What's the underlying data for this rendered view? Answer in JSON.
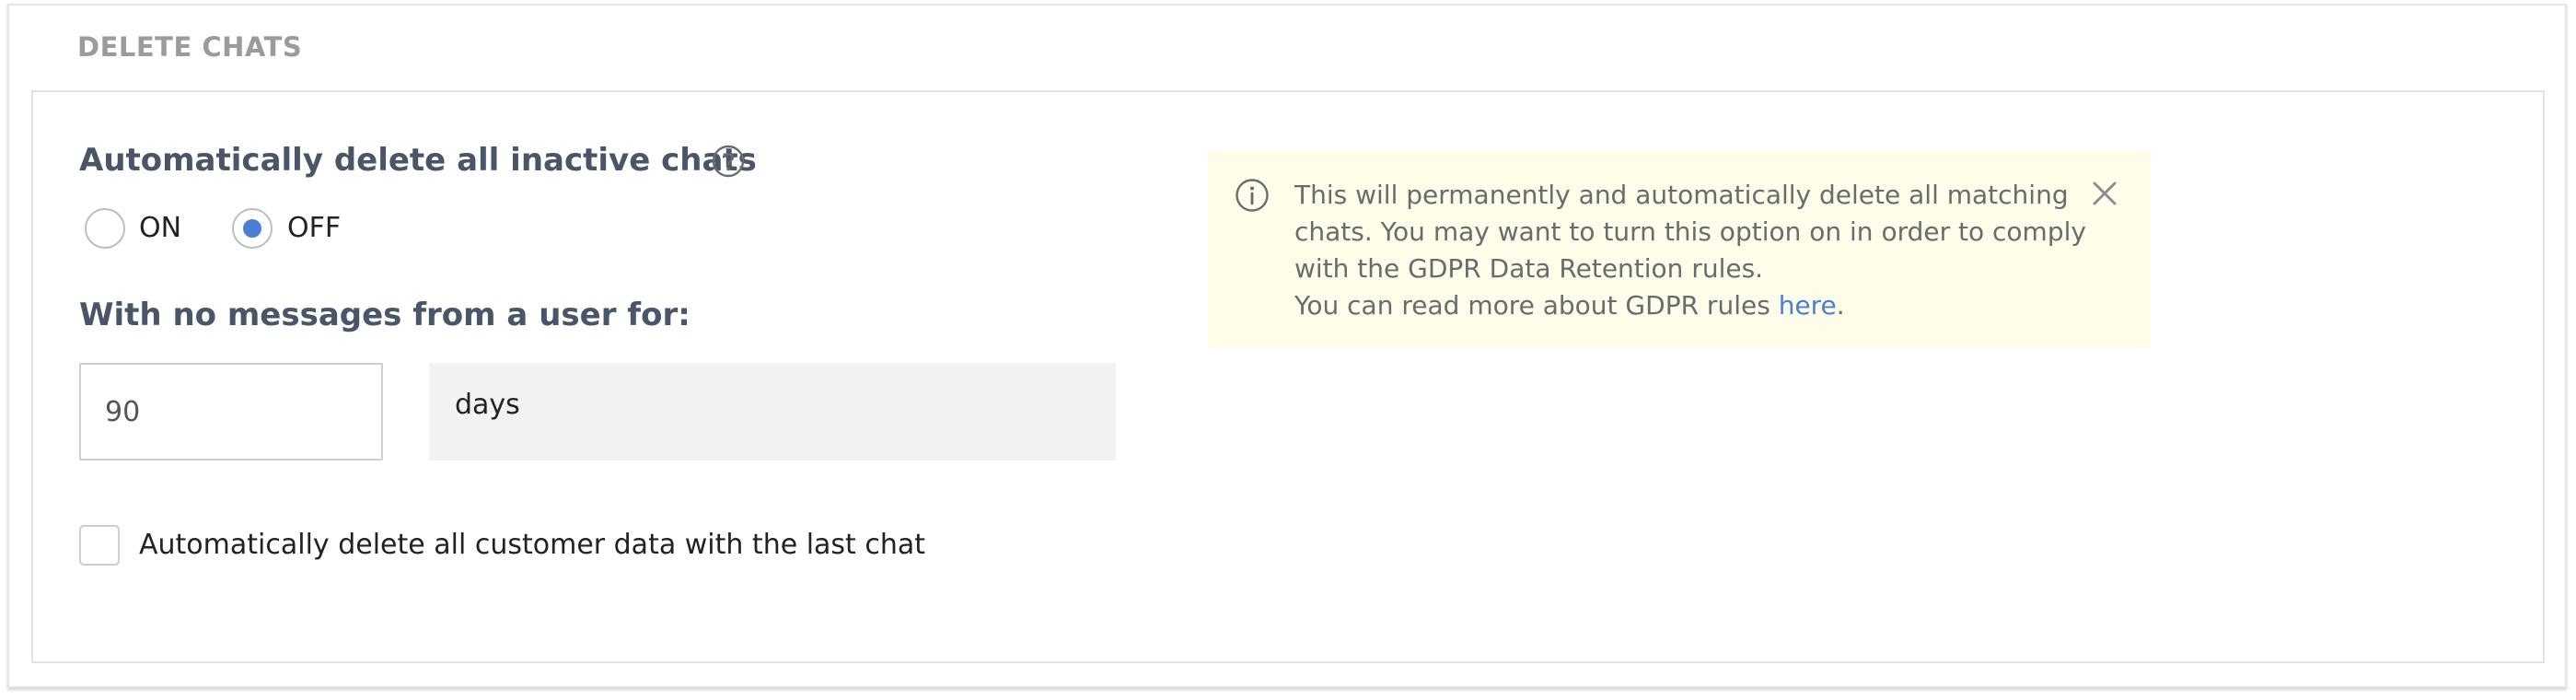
{
  "section": {
    "title": "DELETE CHATS"
  },
  "auto_delete": {
    "heading": "Automatically delete all inactive chats",
    "help_icon": "question-circle-icon",
    "options": [
      {
        "label": "ON",
        "selected": false
      },
      {
        "label": "OFF",
        "selected": true
      }
    ]
  },
  "inactivity": {
    "heading": "With no messages from a user for:",
    "value": "90",
    "unit": "days"
  },
  "customer_data": {
    "label": "Automatically delete all customer data with the last chat",
    "checked": false
  },
  "info": {
    "icon": "info-circle-icon",
    "line1": "This will permanently and automatically delete all matching chats. You may want to turn this option on in order to comply with the GDPR Data Retention rules.",
    "line2_prefix": "You can read more about GDPR rules ",
    "link_text": "here",
    "line2_suffix": ".",
    "close_icon": "close-icon"
  },
  "colors": {
    "accent": "#4a7fd4",
    "heading": "#4a5568",
    "info_background": "#fefde9",
    "section_title": "#9b9b9b"
  }
}
